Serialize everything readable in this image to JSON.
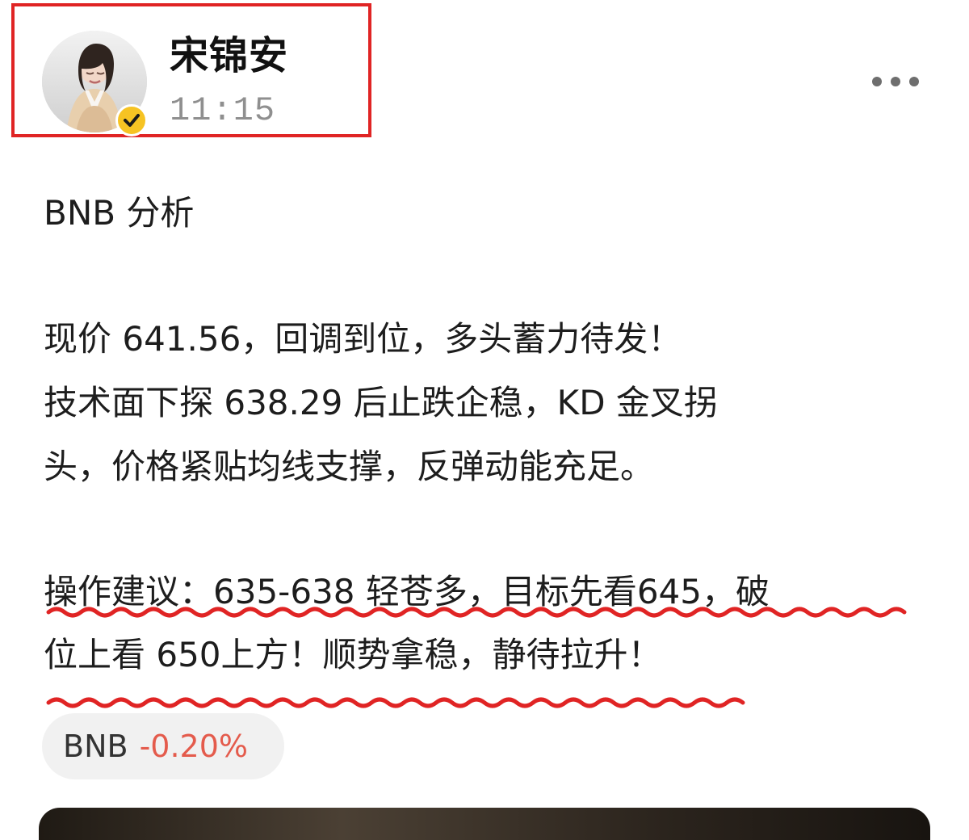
{
  "header": {
    "author_name": "宋锦安",
    "time": "11:15"
  },
  "post": {
    "lines": [
      "BNB 分析",
      "现价 641.56，回调到位，多头蓄力待发！",
      "技术面下探 638.29 后止跌企稳，KD 金叉拐",
      "头，价格紧贴均线支撑，反弹动能充足。",
      "操作建议：635-638 轻苍多，目标先看645，破",
      "位上看 650上方！顺势拿稳，静待拉升！"
    ]
  },
  "ticker": {
    "symbol": "BNB",
    "change": "-0.20%"
  },
  "icons": {
    "verified": "verified-badge-icon",
    "more": "more-options-icon"
  },
  "colors": {
    "highlight_box": "#e02424",
    "squiggle": "#e02424",
    "badge": "#f6c323",
    "ticker_negative": "#e45b4c"
  }
}
